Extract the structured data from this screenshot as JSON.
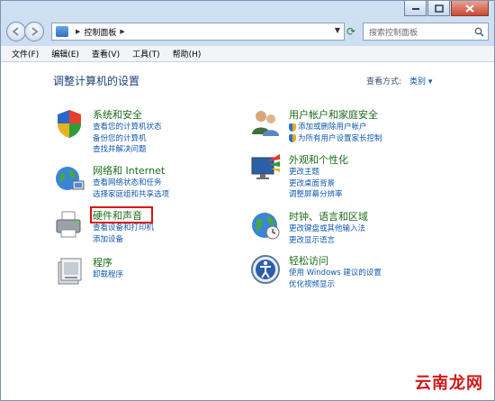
{
  "nav": {
    "address": [
      "控制面板"
    ],
    "search_placeholder": "搜索控制面板"
  },
  "menu": [
    "文件(F)",
    "编辑(E)",
    "查看(V)",
    "工具(T)",
    "帮助(H)"
  ],
  "page": {
    "title": "调整计算机的设置",
    "view_by_label": "查看方式:",
    "view_by_value": "类别 ▾"
  },
  "categories": [
    {
      "title": "系统和安全",
      "links": [
        "查看您的计算机状态",
        "备份您的计算机",
        "查找并解决问题"
      ]
    },
    {
      "title": "网络和 Internet",
      "links": [
        "查看网络状态和任务",
        "选择家庭组和共享选项"
      ]
    },
    {
      "title": "硬件和声音",
      "links": [
        "查看设备和打印机",
        "添加设备"
      ]
    },
    {
      "title": "程序",
      "links": [
        "卸载程序"
      ]
    },
    {
      "title": "用户帐户和家庭安全",
      "links": [
        "添加或删除用户帐户",
        "为所有用户设置家长控制"
      ]
    },
    {
      "title": "外观和个性化",
      "links": [
        "更改主题",
        "更改桌面背景",
        "调整屏幕分辨率"
      ]
    },
    {
      "title": "时钟、语言和区域",
      "links": [
        "更改键盘或其他输入法",
        "更改显示语言"
      ]
    },
    {
      "title": "轻松访问",
      "links": [
        "使用 Windows 建议的设置",
        "优化视频显示"
      ]
    }
  ],
  "watermark": "云南龙网"
}
